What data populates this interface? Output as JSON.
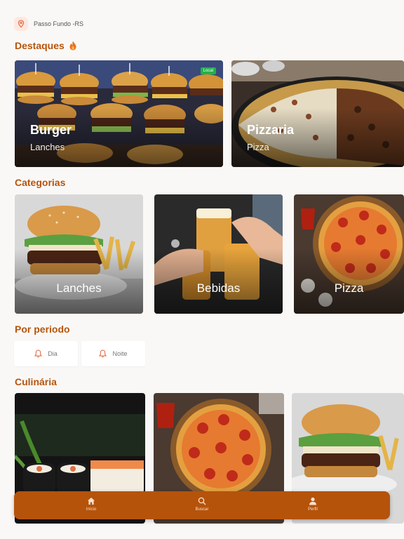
{
  "location": {
    "text": "Passo Fundo -RS",
    "icon": "location-pin-icon"
  },
  "sections": {
    "highlights": "Destaques",
    "categories": "Categorias",
    "period": "Por periodo",
    "cuisine": "Culinária"
  },
  "highlights": [
    {
      "title": "Burger",
      "subtitle": "Lanches",
      "badge": "Local"
    },
    {
      "title": "Pizzaria",
      "subtitle": "Pizza"
    }
  ],
  "categories": [
    {
      "label": "Lanches"
    },
    {
      "label": "Bebidas"
    },
    {
      "label": "Pizza"
    }
  ],
  "period": [
    {
      "label": "Dia",
      "icon": "bell-icon"
    },
    {
      "label": "Noite",
      "icon": "bell-icon"
    }
  ],
  "nav": [
    {
      "label": "Início",
      "icon": "home-icon"
    },
    {
      "label": "Buscar",
      "icon": "search-icon"
    },
    {
      "label": "Perfil",
      "icon": "user-icon"
    }
  ],
  "colors": {
    "accent": "#b5550d",
    "nav": "#b5530b",
    "badge": "#22b14c",
    "background": "#faf8f6"
  }
}
